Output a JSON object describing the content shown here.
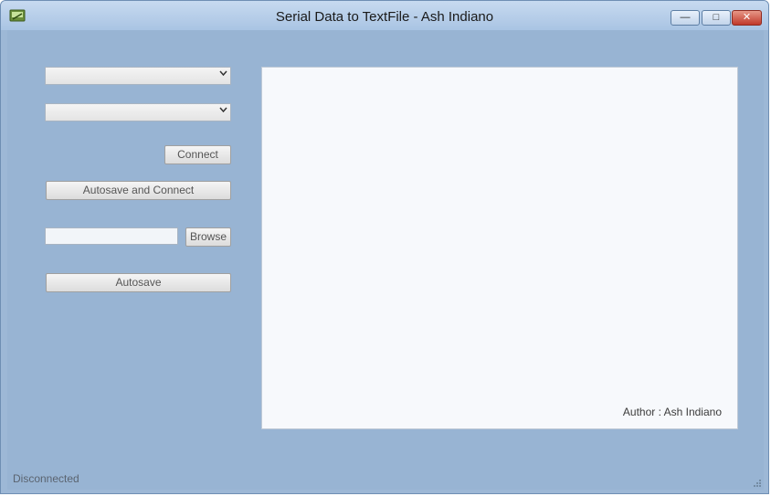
{
  "window": {
    "title": "Serial Data to TextFile - Ash Indiano",
    "minimize_glyph": "—",
    "maximize_glyph": "□",
    "close_glyph": "✕"
  },
  "controls": {
    "port_combo": {
      "value": "",
      "icon": "chevron-down-icon"
    },
    "baud_combo": {
      "value": "",
      "icon": "chevron-down-icon"
    },
    "connect_label": "Connect",
    "autosave_connect_label": "Autosave and Connect",
    "path_value": "",
    "browse_label": "Browse",
    "autosave_label": "Autosave"
  },
  "output": {
    "text": "",
    "author": "Author : Ash Indiano"
  },
  "status": {
    "text": "Disconnected"
  },
  "colors": {
    "window_bg": "#98b4d3",
    "titlebar": "#b8cfe9",
    "close_button": "#c0392b",
    "output_bg": "#f7f9fc"
  }
}
